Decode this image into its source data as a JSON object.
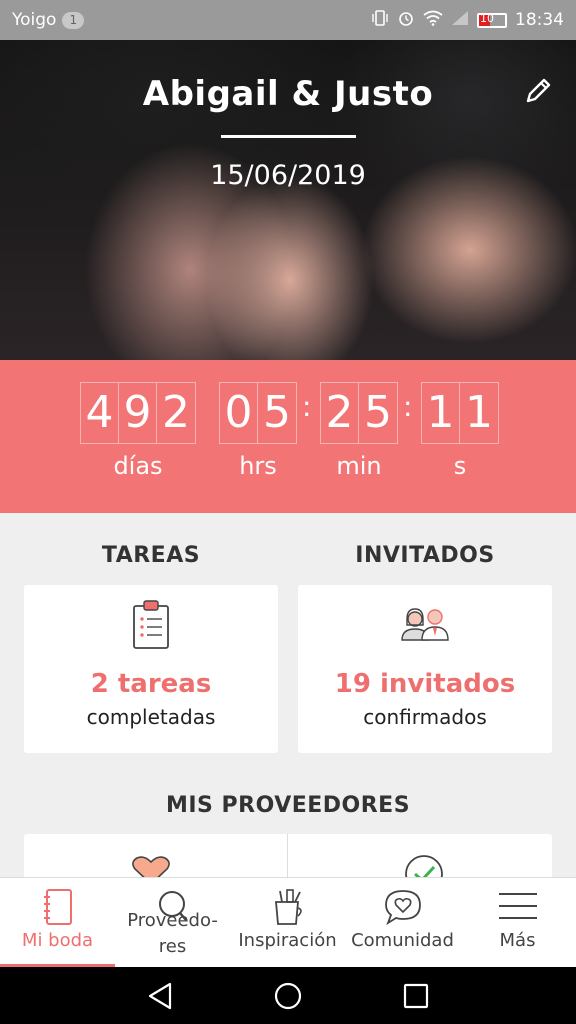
{
  "status_bar": {
    "carrier": "Yoigo",
    "notification_count": "1",
    "battery_level": "10",
    "time": "18:34"
  },
  "hero": {
    "title": "Abigail & Justo",
    "date": "15/06/2019",
    "edit_icon": "pencil-icon"
  },
  "countdown": {
    "days": [
      "4",
      "9",
      "2"
    ],
    "hours": [
      "0",
      "5"
    ],
    "minutes": [
      "2",
      "5"
    ],
    "seconds": [
      "1",
      "1"
    ],
    "labels": {
      "days": "días",
      "hours": "hrs",
      "minutes": "min",
      "seconds": "s"
    }
  },
  "tasks": {
    "heading": "TAREAS",
    "count": "2 tareas",
    "sub": "completadas",
    "icon": "clipboard-icon"
  },
  "guests": {
    "heading": "INVITADOS",
    "count": "19 invitados",
    "sub": "confirmados",
    "icon": "couple-icon"
  },
  "vendors": {
    "heading": "MIS PROVEEDORES",
    "icons": [
      "heart-icon",
      "check-circle-icon"
    ]
  },
  "bottom_nav": [
    {
      "label": "Mi boda",
      "icon": "notebook-icon",
      "active": true
    },
    {
      "label": "Proveedo-\nres",
      "icon": "search-icon",
      "active": false
    },
    {
      "label": "Inspiración",
      "icon": "brush-cup-icon",
      "active": false
    },
    {
      "label": "Comunidad",
      "icon": "chat-heart-icon",
      "active": false
    },
    {
      "label": "Más",
      "icon": "menu-icon",
      "active": false
    }
  ],
  "colors": {
    "accent": "#f27474",
    "accent_text": "#ef6f6f"
  }
}
